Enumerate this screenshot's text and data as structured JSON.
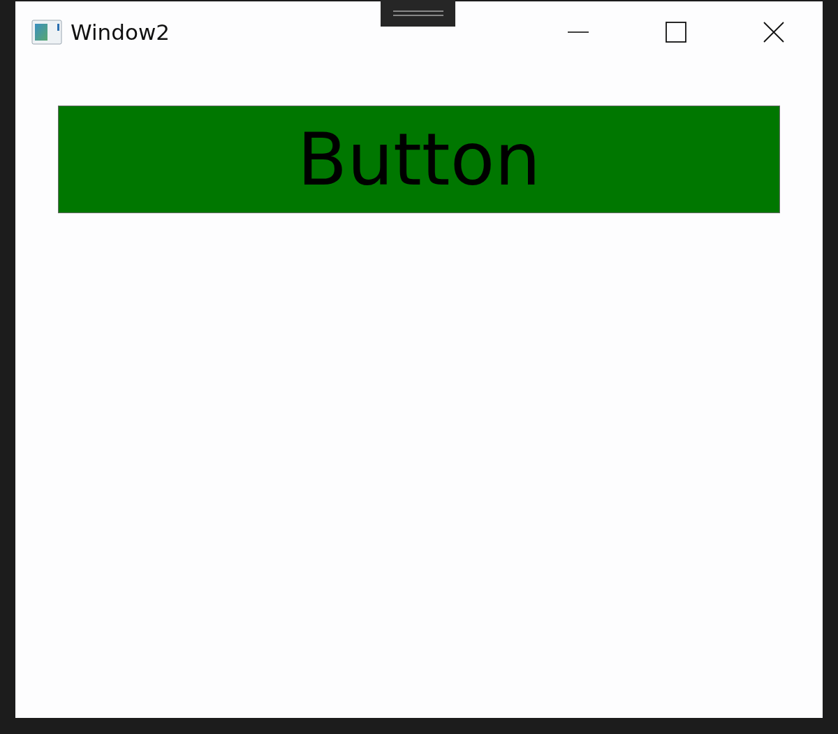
{
  "window": {
    "title": "Window2"
  },
  "button": {
    "label": "Button"
  }
}
